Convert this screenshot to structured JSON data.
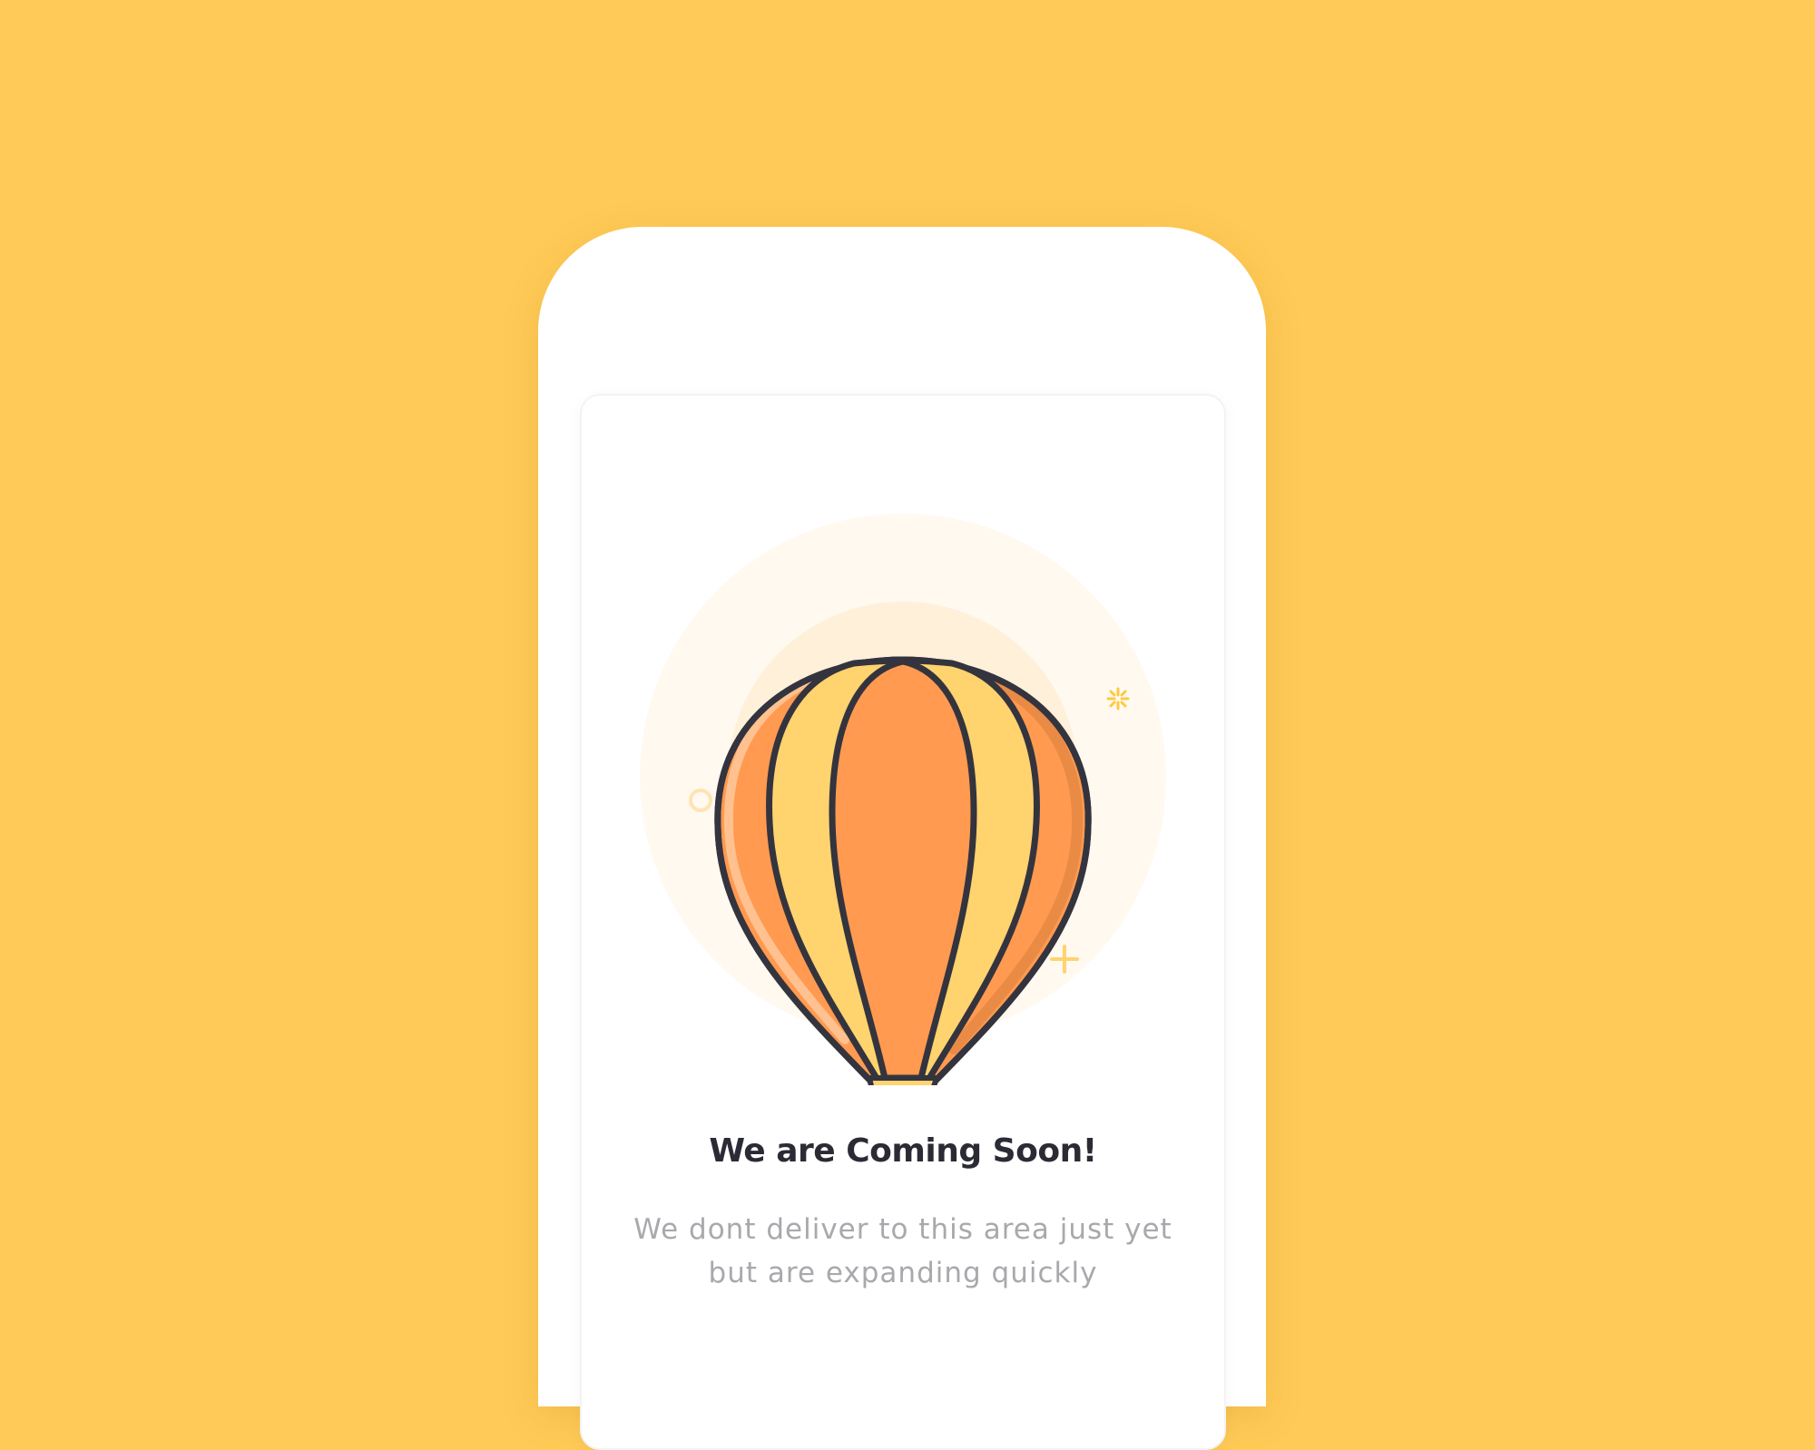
{
  "screen": {
    "title": "We are Coming Soon!",
    "message_line_1": "We dont deliver to this area just yet",
    "message_line_2": "but are expanding quickly"
  },
  "illustration": {
    "icon": "hot-air-balloon-icon",
    "decorations": [
      "sparkle-icon",
      "plus-icon",
      "ring-icon"
    ]
  },
  "colors": {
    "background": "#FFCA57",
    "balloon_orange": "#FF9A50",
    "balloon_yellow": "#FFD36E",
    "outline": "#34343E",
    "sparkle_pink": "#F5788A"
  }
}
